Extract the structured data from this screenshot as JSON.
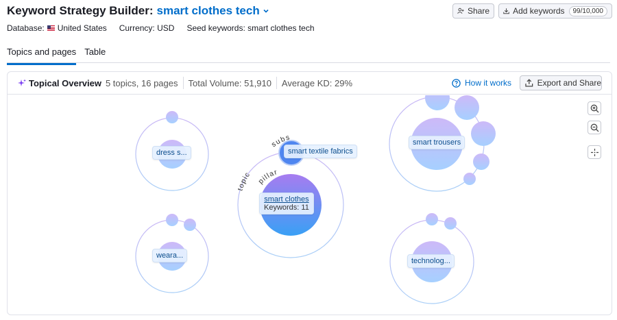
{
  "header": {
    "title": "Keyword Strategy Builder:",
    "seed": "smart clothes tech",
    "share_label": "Share",
    "add_keywords_label": "Add keywords",
    "keyword_counter": "99/10,000"
  },
  "meta": {
    "database_label": "Database:",
    "database_value": "United States",
    "currency": "Currency: USD",
    "seed_keywords": "Seed keywords: smart clothes tech"
  },
  "tabs": [
    {
      "label": "Topics and pages",
      "active": true
    },
    {
      "label": "Table",
      "active": false
    }
  ],
  "overview": {
    "title": "Topical Overview",
    "summary": "5 topics, 16 pages",
    "total_volume": "Total Volume: 51,910",
    "average_kd": "Average KD: 29%",
    "how_it_works": "How it works",
    "export_label": "Export and Share"
  },
  "graph": {
    "pillar": {
      "name": "smart clothes",
      "keywords": "Keywords: 11"
    },
    "subtopic": "smart textile fabrics",
    "ring_labels": {
      "topic": "topic",
      "subs": "subs",
      "pillar": "pillar"
    },
    "topics": [
      {
        "label": "dress s..."
      },
      {
        "label": "weara..."
      },
      {
        "label": "smart trousers"
      },
      {
        "label": "technolog..."
      }
    ]
  },
  "colors": {
    "accent": "#006dca",
    "bubble_top": "#c9b6f7",
    "bubble_bottom": "#a9d2ff",
    "pillar_top": "#a77cf0",
    "pillar_bottom": "#39a0f5"
  },
  "icons": [
    "chevron-down-icon",
    "person-add-icon",
    "download-icon",
    "sparkle-icon",
    "help-circle-icon",
    "export-icon",
    "zoom-in-icon",
    "zoom-out-icon",
    "fit-center-icon"
  ]
}
